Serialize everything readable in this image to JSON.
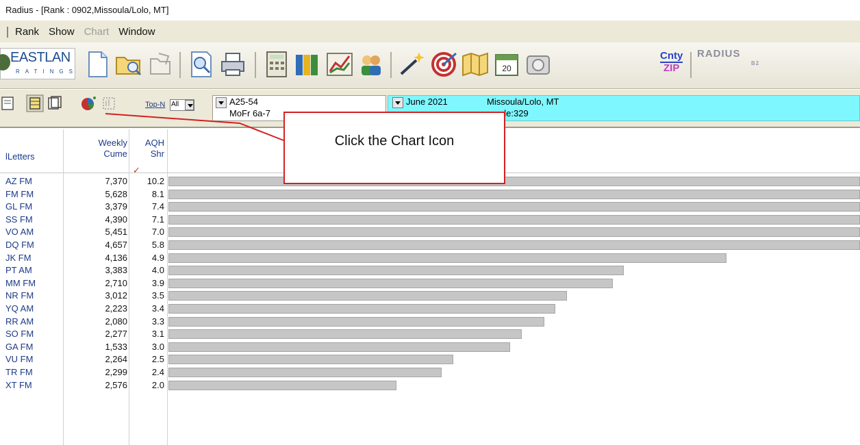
{
  "window": {
    "title": "Radius  - [Rank : 0902,Missoula/Lolo, MT]"
  },
  "menu": [
    {
      "label": "Rank",
      "disabled": false
    },
    {
      "label": "Show",
      "disabled": false
    },
    {
      "label": "Chart",
      "disabled": true
    },
    {
      "label": "Window",
      "disabled": false
    }
  ],
  "toolbar": {
    "logo_text": "EASTLAN",
    "logo_sub": "RATINGS",
    "cnty_label": "Cnty",
    "zip_label": "ZIP",
    "calendar_day": "20",
    "radius_logo": "RADIUS",
    "radius_sub": "B2",
    "icons": [
      "new-document-icon",
      "open-folder-icon",
      "open-file-icon",
      "find-icon",
      "print-icon",
      "calculator-icon",
      "book-icon",
      "line-chart-icon",
      "people-icon",
      "magic-wand-icon",
      "target-icon",
      "map-icon",
      "calendar-icon",
      "phone-icon",
      "cnty-zip-icon"
    ]
  },
  "filters": {
    "topn_label": "Top-N",
    "topn_value": "All",
    "demo_line1": "A25-54",
    "demo_line2": "MoFr 6a-7",
    "period": "June 2021",
    "market": "Missoula/Lolo, MT",
    "sample": "ample:329"
  },
  "columns": {
    "call": "lLetters",
    "cume_l1": "Weekly",
    "cume_l2": "Cume",
    "aqh_l1": "AQH",
    "aqh_l2": "Shr"
  },
  "callout": {
    "text": "Click the Chart Icon"
  },
  "rows": [
    {
      "call": "AZ FM",
      "cume": "7,370",
      "aqh": "10.2",
      "share": 10.2
    },
    {
      "call": "FM FM",
      "cume": "5,628",
      "aqh": "8.1",
      "share": 8.1
    },
    {
      "call": "GL FM",
      "cume": "3,379",
      "aqh": "7.4",
      "share": 7.4
    },
    {
      "call": "SS FM",
      "cume": "4,390",
      "aqh": "7.1",
      "share": 7.1
    },
    {
      "call": "VO AM",
      "cume": "5,451",
      "aqh": "7.0",
      "share": 7.0
    },
    {
      "call": "DQ FM",
      "cume": "4,657",
      "aqh": "5.8",
      "share": 5.8
    },
    {
      "call": "JK FM",
      "cume": "4,136",
      "aqh": "4.9",
      "share": 4.9
    },
    {
      "call": "PT AM",
      "cume": "3,383",
      "aqh": "4.0",
      "share": 4.0
    },
    {
      "call": "MM FM",
      "cume": "2,710",
      "aqh": "3.9",
      "share": 3.9
    },
    {
      "call": "NR FM",
      "cume": "3,012",
      "aqh": "3.5",
      "share": 3.5
    },
    {
      "call": "YQ AM",
      "cume": "2,223",
      "aqh": "3.4",
      "share": 3.4
    },
    {
      "call": "RR AM",
      "cume": "2,080",
      "aqh": "3.3",
      "share": 3.3
    },
    {
      "call": "SO FM",
      "cume": "2,277",
      "aqh": "3.1",
      "share": 3.1
    },
    {
      "call": "GA FM",
      "cume": "1,533",
      "aqh": "3.0",
      "share": 3.0
    },
    {
      "call": "VU FM",
      "cume": "2,264",
      "aqh": "2.5",
      "share": 2.5
    },
    {
      "call": "TR FM",
      "cume": "2,299",
      "aqh": "2.4",
      "share": 2.4
    },
    {
      "call": "XT FM",
      "cume": "2,576",
      "aqh": "2.0",
      "share": 2.0
    }
  ],
  "colors": {
    "bar_fill": "#c6c6c6",
    "highlight": "#7ff7ff",
    "callout_border": "#d32020"
  }
}
